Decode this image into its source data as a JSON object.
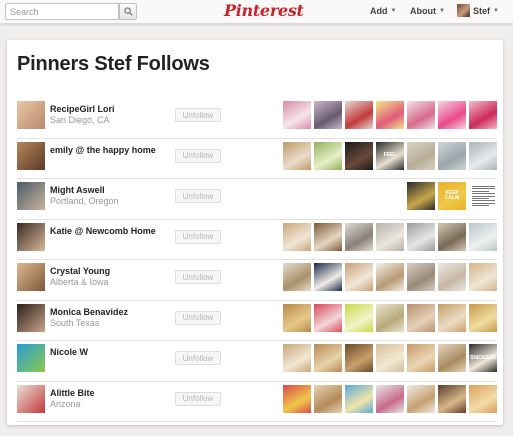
{
  "header": {
    "search_placeholder": "Search",
    "logo": "Pinterest",
    "nav": {
      "add": "Add",
      "about": "About",
      "user": "Stef"
    }
  },
  "page": {
    "title": "Pinners Stef Follows"
  },
  "unfollow_label": "Unfollow",
  "colors": {
    "brand_red": "#c8232c",
    "divider": "#e3e1e1"
  },
  "pinners": [
    {
      "name": "RecipeGirl Lori",
      "location": "San Diego, CA",
      "avatar": [
        "#e9c7a8",
        "#b78a6a"
      ],
      "boards": [
        {
          "c": [
            "#d98aa8",
            "#f4e6ec"
          ]
        },
        {
          "c": [
            "#c9b9c9",
            "#6a5a70"
          ]
        },
        {
          "c": [
            "#e6d7d2",
            "#c23a3a"
          ]
        },
        {
          "c": [
            "#f2e58a",
            "#e05c7a"
          ]
        },
        {
          "c": [
            "#f3e3e8",
            "#d76a8d"
          ]
        },
        {
          "c": [
            "#f7d3e0",
            "#e94a8a"
          ]
        },
        {
          "c": [
            "#f6b9cc",
            "#cc2a5a"
          ]
        }
      ]
    },
    {
      "name": "emily @ the happy home",
      "location": "",
      "avatar": [
        "#b6865a",
        "#5a3a28"
      ],
      "boards": [
        {
          "c": [
            "#c29a6a",
            "#e8dcc8"
          ]
        },
        {
          "c": [
            "#8fb35a",
            "#e8eec8"
          ]
        },
        {
          "c": [
            "#1a1a1a",
            "#6a4a3a"
          ]
        },
        {
          "c": [
            "#2a2a2a",
            "#e8e0d0"
          ],
          "label": "FEEL"
        },
        {
          "c": [
            "#d9d3c3",
            "#b8ad98"
          ]
        },
        {
          "c": [
            "#cfd6d8",
            "#9aa6aa"
          ]
        },
        {
          "c": [
            "#aab4b8",
            "#e6eaea"
          ]
        }
      ]
    },
    {
      "name": "Might Aswell",
      "location": "Portland, Oregon",
      "avatar": [
        "#4a5a6a",
        "#c9b59a"
      ],
      "boards": [
        {
          "c": [
            "#2a2a2a",
            "#c8a84a"
          ]
        },
        {
          "c": [
            "#e8b22a",
            "#f0c848"
          ],
          "label": "KEEP CALM"
        },
        {
          "text": true
        }
      ]
    },
    {
      "name": "Katie @ Newcomb Home",
      "location": "",
      "avatar": [
        "#3a2a24",
        "#d8b89a"
      ],
      "boards": [
        {
          "c": [
            "#c9a67a",
            "#f0e6d6"
          ]
        },
        {
          "c": [
            "#7a5a3a",
            "#e6d6c0"
          ]
        },
        {
          "c": [
            "#e0dcd4",
            "#8a8078"
          ]
        },
        {
          "c": [
            "#b8b0a6",
            "#eae6e0"
          ]
        },
        {
          "c": [
            "#9a9a9a",
            "#e6e6e6"
          ]
        },
        {
          "c": [
            "#d6c8b4",
            "#7a6a58"
          ]
        },
        {
          "c": [
            "#b8c6c8",
            "#eef0ee"
          ]
        }
      ]
    },
    {
      "name": "Crystal Young",
      "location": "Alberta & Iowa",
      "avatar": [
        "#e0b890",
        "#7a5a3a"
      ],
      "boards": [
        {
          "c": [
            "#e6dccd",
            "#a89068"
          ]
        },
        {
          "c": [
            "#1c2a48",
            "#f0ece6"
          ]
        },
        {
          "c": [
            "#caa07a",
            "#f2e8d8"
          ]
        },
        {
          "c": [
            "#f4efe6",
            "#b89a74"
          ]
        },
        {
          "c": [
            "#d8cfc4",
            "#9a8a78"
          ]
        },
        {
          "c": [
            "#ece8e2",
            "#c8b8a4"
          ]
        },
        {
          "c": [
            "#d4b48a",
            "#f0e6d4"
          ]
        }
      ]
    },
    {
      "name": "Monica Benavidez",
      "location": "South Texas",
      "avatar": [
        "#2a1e1a",
        "#c9a58a"
      ],
      "boards": [
        {
          "c": [
            "#b88a4a",
            "#e6c88a"
          ]
        },
        {
          "c": [
            "#d64a5a",
            "#f2d6d8"
          ]
        },
        {
          "c": [
            "#c8d84a",
            "#f2f4c8"
          ]
        },
        {
          "c": [
            "#eae4d0",
            "#b8aa7a"
          ]
        },
        {
          "c": [
            "#b89070",
            "#e6d0b8"
          ]
        },
        {
          "c": [
            "#c8a06a",
            "#eadcc4"
          ]
        },
        {
          "c": [
            "#c89a4a",
            "#f0dca0"
          ]
        }
      ]
    },
    {
      "name": "Nicole W",
      "location": "",
      "avatar": [
        "#2a9ad8",
        "#8acb4a"
      ],
      "boards": [
        {
          "c": [
            "#c8a678",
            "#f2e8d4"
          ]
        },
        {
          "c": [
            "#b88a58",
            "#e8d2aa"
          ]
        },
        {
          "c": [
            "#6a4a2a",
            "#c8a06a"
          ]
        },
        {
          "c": [
            "#d4c09a",
            "#f2e8d2"
          ]
        },
        {
          "c": [
            "#c89a6a",
            "#ead6b4"
          ]
        },
        {
          "c": [
            "#e6d8c0",
            "#a88a60"
          ]
        },
        {
          "c": [
            "#2a2a2a",
            "#f0e8d8"
          ],
          "label": "SNICKERS"
        }
      ]
    },
    {
      "name": "Alittle Bite",
      "location": "Arizona",
      "avatar": [
        "#e8e0d8",
        "#c23a3a"
      ],
      "boards": [
        {
          "c": [
            "#d84a4a",
            "#f0c84a"
          ]
        },
        {
          "c": [
            "#e8d4b0",
            "#b48a5a"
          ]
        },
        {
          "c": [
            "#58a8d8",
            "#f2e6a8"
          ]
        },
        {
          "c": [
            "#e6e8ea",
            "#c86a8a"
          ]
        },
        {
          "c": [
            "#f0ece4",
            "#c8a070"
          ]
        },
        {
          "c": [
            "#5a3a2a",
            "#d8b888"
          ]
        },
        {
          "c": [
            "#d8a05a",
            "#f2dca8"
          ]
        }
      ]
    }
  ]
}
